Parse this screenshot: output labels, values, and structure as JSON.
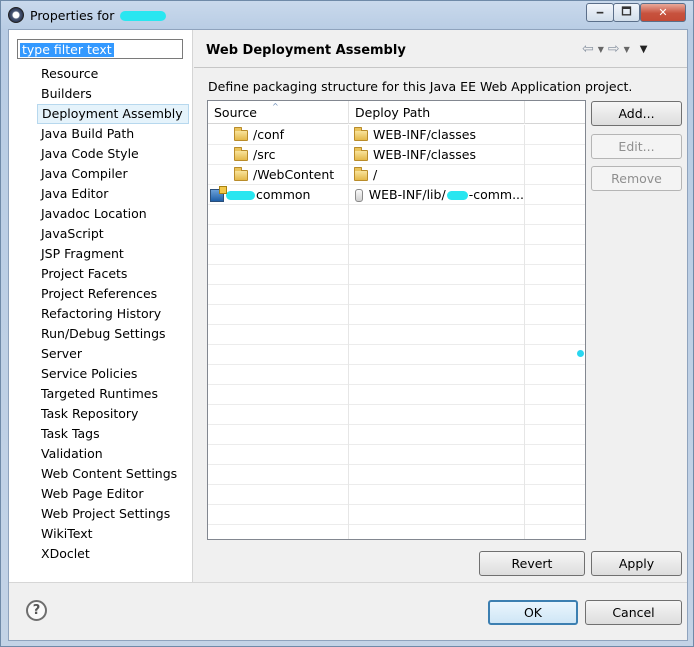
{
  "window": {
    "title": "Properties for",
    "minimize": "🗕",
    "maximize": "🗖",
    "close": "✕"
  },
  "sidebar": {
    "filter_placeholder": "type filter text",
    "items": [
      "Resource",
      "Builders",
      "Deployment Assembly",
      "Java Build Path",
      "Java Code Style",
      "Java Compiler",
      "Java Editor",
      "Javadoc Location",
      "JavaScript",
      "JSP Fragment",
      "Project Facets",
      "Project References",
      "Refactoring History",
      "Run/Debug Settings",
      "Server",
      "Service Policies",
      "Targeted Runtimes",
      "Task Repository",
      "Task Tags",
      "Validation",
      "Web Content Settings",
      "Web Page Editor",
      "Web Project Settings",
      "WikiText",
      "XDoclet"
    ],
    "selected_index": 2
  },
  "page": {
    "title": "Web Deployment Assembly",
    "description": "Define packaging structure for this Java EE Web Application project.",
    "nav": {
      "back": "⇦",
      "forward": "⇨",
      "dropdown": "▼"
    }
  },
  "table": {
    "columns": [
      "Source",
      "Deploy Path"
    ],
    "sort_indicator": "^",
    "rows": [
      {
        "source": "/conf",
        "deploy": "WEB-INF/classes",
        "icon": "folder-icon",
        "deploy_icon": "folder-icon"
      },
      {
        "source": "/src",
        "deploy": "WEB-INF/classes",
        "icon": "folder-icon",
        "deploy_icon": "folder-icon"
      },
      {
        "source": "/WebContent",
        "deploy": "/",
        "icon": "folder-icon",
        "deploy_icon": "folder-icon"
      },
      {
        "source": "common",
        "deploy_prefix": "WEB-INF/lib/",
        "deploy_suffix": "-comm...",
        "icon": "project-icon",
        "deploy_icon": "jar-icon"
      }
    ]
  },
  "buttons": {
    "add": "Add...",
    "edit": "Edit...",
    "remove": "Remove",
    "revert": "Revert",
    "apply": "Apply",
    "ok": "OK",
    "cancel": "Cancel",
    "help": "?"
  }
}
